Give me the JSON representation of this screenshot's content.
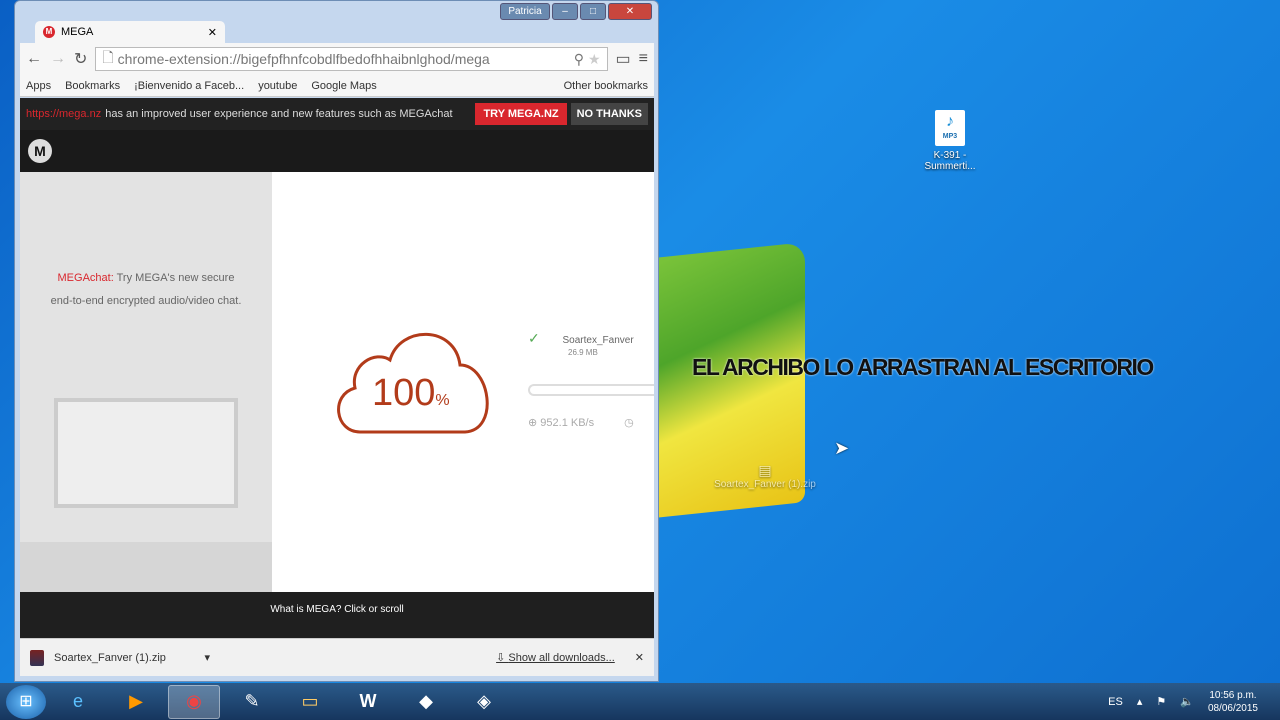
{
  "browser": {
    "profile": "Patricia",
    "tab_title": "MEGA",
    "url": "chrome-extension://bigefpfhnfcobdlfbedofhhaibnlghod/mega",
    "bookmarks": [
      "Apps",
      "Bookmarks",
      "¡Bienvenido a Faceb...",
      "youtube",
      "Google Maps"
    ],
    "other_bookmarks": "Other bookmarks"
  },
  "notice": {
    "link": "https://mega.nz",
    "text": "has an improved user experience and new features such as MEGAchat",
    "try": "TRY MEGA.NZ",
    "no": "NO THANKS"
  },
  "mega": {
    "chat_label": "MEGAchat:",
    "chat_text": "Try MEGA's new secure end-to-end encrypted audio/video chat.",
    "percent": "100",
    "percent_sign": "%",
    "progress": 1.0,
    "file_name": "Soartex_Fanver",
    "file_size": "26.9 MB",
    "speed": "952.1 KB/s",
    "footer": "What is MEGA? Click or scroll"
  },
  "downloads": {
    "file": "Soartex_Fanver (1).zip",
    "show_all": "Show all downloads..."
  },
  "desktop": {
    "overlay": "EL ARCHIBO LO ARRASTRAN AL ESCRITORIO",
    "mp3_label": "K-391 - Summerti...",
    "mp3_badge": "MP3",
    "dragged_label": "Soartex_Fanver (1).zip"
  },
  "taskbar": {
    "lang": "ES",
    "time": "10:56 p.m.",
    "date": "08/06/2015"
  }
}
